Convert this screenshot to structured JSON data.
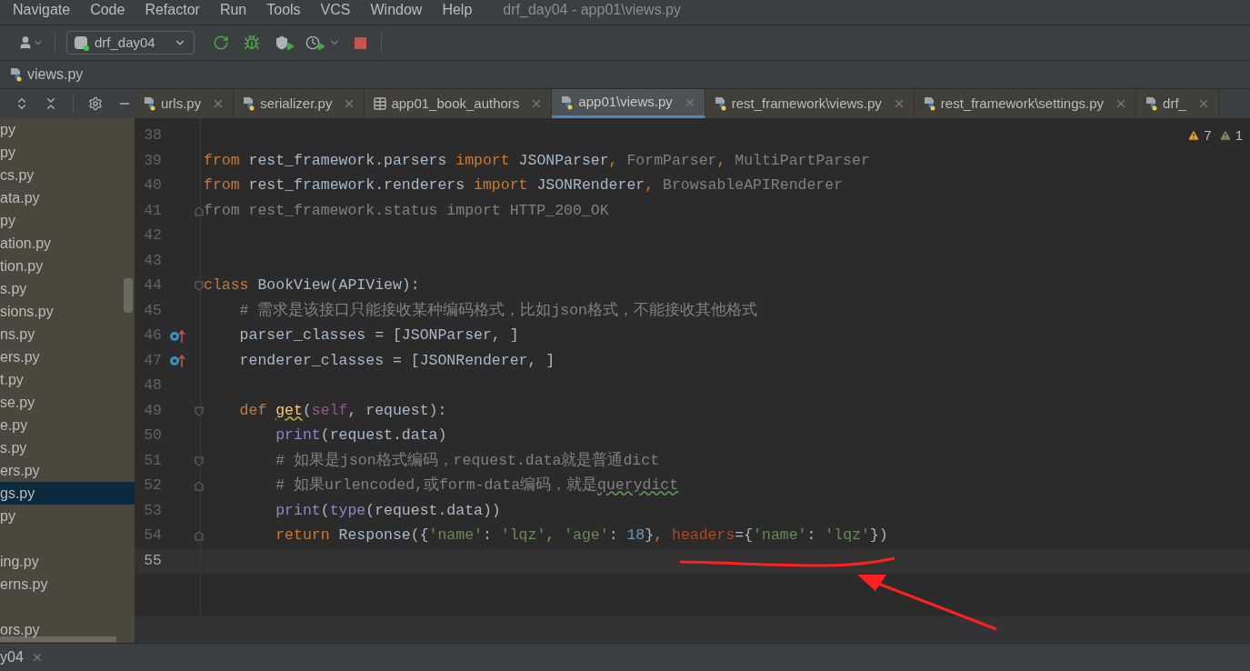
{
  "menu": [
    {
      "label": "Navigate"
    },
    {
      "label": "Code"
    },
    {
      "label": "Refactor"
    },
    {
      "label": "Run"
    },
    {
      "label": "Tools"
    },
    {
      "label": "VCS"
    },
    {
      "label": "Window"
    },
    {
      "label": "Help"
    }
  ],
  "window": {
    "title": "drf_day04 - app01\\views.py"
  },
  "toolbar": {
    "run_config": "drf_day04"
  },
  "breadcrumb": "views.py",
  "tabs": [
    {
      "label": "urls.py",
      "kind": "python",
      "selected": false
    },
    {
      "label": "serializer.py",
      "kind": "python",
      "selected": false
    },
    {
      "label": "app01_book_authors",
      "kind": "table",
      "selected": false
    },
    {
      "label": "app01\\views.py",
      "kind": "python",
      "selected": true
    },
    {
      "label": "rest_framework\\views.py",
      "kind": "python",
      "selected": false
    },
    {
      "label": "rest_framework\\settings.py",
      "kind": "python",
      "selected": false
    },
    {
      "label": "drf_",
      "kind": "python",
      "selected": false
    }
  ],
  "sidebar": {
    "items": [
      {
        "kind": "file",
        "label": "py",
        "selected": false
      },
      {
        "kind": "file",
        "label": "py",
        "selected": false
      },
      {
        "kind": "file",
        "label": "cs.py",
        "selected": false
      },
      {
        "kind": "file",
        "label": "ata.py",
        "selected": false
      },
      {
        "kind": "file",
        "label": "py",
        "selected": false
      },
      {
        "kind": "file",
        "label": "ation.py",
        "selected": false
      },
      {
        "kind": "file",
        "label": "tion.py",
        "selected": false
      },
      {
        "kind": "file",
        "label": "s.py",
        "selected": false
      },
      {
        "kind": "file",
        "label": "sions.py",
        "selected": false
      },
      {
        "kind": "file",
        "label": "ns.py",
        "selected": false
      },
      {
        "kind": "file",
        "label": "ers.py",
        "selected": false
      },
      {
        "kind": "file",
        "label": "t.py",
        "selected": false
      },
      {
        "kind": "file",
        "label": "se.py",
        "selected": false
      },
      {
        "kind": "file",
        "label": "e.py",
        "selected": false
      },
      {
        "kind": "file",
        "label": "s.py",
        "selected": false
      },
      {
        "kind": "file",
        "label": "ers.py",
        "selected": false
      },
      {
        "kind": "file",
        "label": "gs.py",
        "selected": true
      },
      {
        "kind": "file",
        "label": "py",
        "selected": false
      },
      {
        "kind": "blank"
      },
      {
        "kind": "file",
        "label": "ing.py",
        "selected": false
      },
      {
        "kind": "file",
        "label": "erns.py",
        "selected": false
      },
      {
        "kind": "blank"
      },
      {
        "kind": "file",
        "label": "ors.py",
        "selected": false
      }
    ]
  },
  "inspections": {
    "warnings": "7",
    "weak_warnings": "1"
  },
  "editor": {
    "lines": [
      {
        "number": "38",
        "current": false,
        "fold_start": false,
        "fold_end": false,
        "override": false
      },
      {
        "number": "39",
        "current": false,
        "fold_start": false,
        "fold_end": false,
        "override": false,
        "tokens": [
          {
            "text": "from ",
            "kind": "keyword"
          },
          {
            "text": "rest_framework.parsers ",
            "kind": "plain"
          },
          {
            "text": "import ",
            "kind": "keyword"
          },
          {
            "text": "JSONParser",
            "kind": "plain"
          },
          {
            "text": ", ",
            "kind": "keyword"
          },
          {
            "text": "FormParser",
            "kind": "unused"
          },
          {
            "text": ", ",
            "kind": "keyword"
          },
          {
            "text": "MultiPartParser",
            "kind": "unused"
          }
        ]
      },
      {
        "number": "40",
        "current": false,
        "fold_start": false,
        "fold_end": false,
        "override": false,
        "tokens": [
          {
            "text": "from ",
            "kind": "keyword"
          },
          {
            "text": "rest_framework.renderers ",
            "kind": "plain"
          },
          {
            "text": "import ",
            "kind": "keyword"
          },
          {
            "text": "JSONRenderer",
            "kind": "plain"
          },
          {
            "text": ", ",
            "kind": "keyword"
          },
          {
            "text": "BrowsableAPIRenderer",
            "kind": "unused"
          }
        ]
      },
      {
        "number": "41",
        "current": false,
        "fold_start": false,
        "fold_end": true,
        "override": false,
        "tokens": [
          {
            "text": "from rest_framework.status import HTTP_200_OK",
            "kind": "unused"
          }
        ]
      },
      {
        "number": "42",
        "current": false,
        "fold_start": false,
        "fold_end": false,
        "override": false
      },
      {
        "number": "43",
        "current": false,
        "fold_start": false,
        "fold_end": false,
        "override": false
      },
      {
        "number": "44",
        "current": false,
        "fold_start": true,
        "fold_end": false,
        "override": false,
        "tokens": [
          {
            "text": "class ",
            "kind": "keyword"
          },
          {
            "text": "BookView(APIView):",
            "kind": "plain"
          }
        ]
      },
      {
        "number": "45",
        "current": false,
        "fold_start": false,
        "fold_end": false,
        "override": false,
        "tokens": [
          {
            "text": "    # 需求是该接口只能接收某种编码格式，比如json格式，不能接收其他格式",
            "kind": "comment"
          }
        ]
      },
      {
        "number": "46",
        "current": false,
        "fold_start": false,
        "fold_end": false,
        "override": true,
        "tokens": [
          {
            "text": "    parser_classes = [JSONParser, ]",
            "kind": "plain"
          }
        ]
      },
      {
        "number": "47",
        "current": false,
        "fold_start": false,
        "fold_end": false,
        "override": true,
        "tokens": [
          {
            "text": "    renderer_classes = [JSONRenderer, ]",
            "kind": "plain"
          }
        ]
      },
      {
        "number": "48",
        "current": false,
        "fold_start": false,
        "fold_end": false,
        "override": false
      },
      {
        "number": "49",
        "current": false,
        "fold_start": true,
        "fold_end": false,
        "override": false,
        "tokens": [
          {
            "text": "    def ",
            "kind": "keyword"
          },
          {
            "text": "get",
            "kind": "function_warned"
          },
          {
            "text": "(",
            "kind": "plain"
          },
          {
            "text": "self",
            "kind": "self"
          },
          {
            "text": ", request):",
            "kind": "plain"
          }
        ]
      },
      {
        "number": "50",
        "current": false,
        "fold_start": false,
        "fold_end": false,
        "override": false,
        "tokens": [
          {
            "text": "        print",
            "kind": "builtin"
          },
          {
            "text": "(request.data)",
            "kind": "plain"
          }
        ]
      },
      {
        "number": "51",
        "current": false,
        "fold_start": true,
        "fold_end": false,
        "override": false,
        "tokens": [
          {
            "text": "        # 如果是json格式编码，request.data就是普通dict",
            "kind": "comment"
          }
        ]
      },
      {
        "number": "52",
        "current": false,
        "fold_start": false,
        "fold_end": true,
        "override": false,
        "tokens": [
          {
            "text": "        # 如果urlencoded,或form-data编码，就是",
            "kind": "comment"
          },
          {
            "text": "querydict",
            "kind": "comment_typo"
          }
        ]
      },
      {
        "number": "53",
        "current": false,
        "fold_start": false,
        "fold_end": false,
        "override": false,
        "tokens": [
          {
            "text": "        print",
            "kind": "builtin"
          },
          {
            "text": "(",
            "kind": "plain"
          },
          {
            "text": "type",
            "kind": "builtin"
          },
          {
            "text": "(request.data))",
            "kind": "plain"
          }
        ]
      },
      {
        "number": "54",
        "current": false,
        "fold_start": false,
        "fold_end": true,
        "override": false,
        "tokens": [
          {
            "text": "        return ",
            "kind": "keyword"
          },
          {
            "text": "Response({",
            "kind": "plain"
          },
          {
            "text": "'name'",
            "kind": "string"
          },
          {
            "text": ": ",
            "kind": "plain"
          },
          {
            "text": "'lqz'",
            "kind": "string"
          },
          {
            "text": ", ",
            "kind": "keyword"
          },
          {
            "text": "'age'",
            "kind": "string"
          },
          {
            "text": ": ",
            "kind": "plain"
          },
          {
            "text": "18",
            "kind": "number"
          },
          {
            "text": "}",
            "kind": "plain"
          },
          {
            "text": ", ",
            "kind": "keyword"
          },
          {
            "text": "headers",
            "kind": "param"
          },
          {
            "text": "={",
            "kind": "plain"
          },
          {
            "text": "'name'",
            "kind": "string"
          },
          {
            "text": ": ",
            "kind": "plain"
          },
          {
            "text": "'lqz'",
            "kind": "string"
          },
          {
            "text": "})",
            "kind": "plain"
          }
        ]
      },
      {
        "number": "55",
        "current": true,
        "fold_start": false,
        "fold_end": false,
        "override": false
      }
    ]
  },
  "status_bar": {
    "tool_tab": "y04"
  }
}
